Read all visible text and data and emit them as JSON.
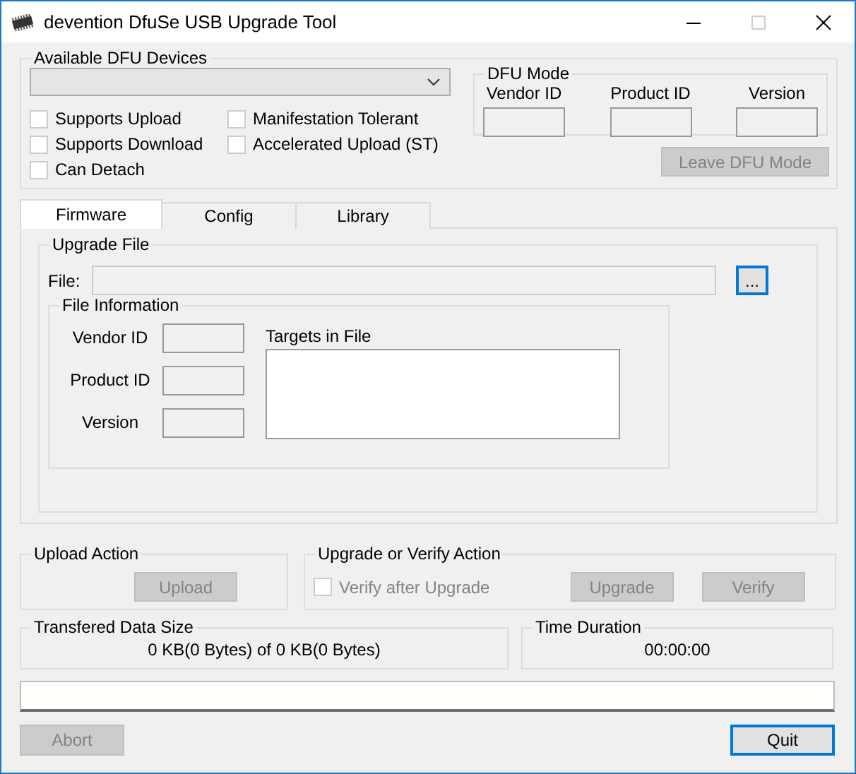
{
  "window": {
    "title": "devention DfuSe USB Upgrade Tool"
  },
  "devices": {
    "title": "Available DFU Devices",
    "capabilities": [
      {
        "label": "Supports Upload",
        "checked": false
      },
      {
        "label": "Supports Download",
        "checked": false
      },
      {
        "label": "Can Detach",
        "checked": false
      },
      {
        "label": "Manifestation Tolerant",
        "checked": false
      },
      {
        "label": "Accelerated Upload (ST)",
        "checked": false
      }
    ],
    "dfu_mode": {
      "title": "DFU Mode",
      "fields": [
        "Vendor ID",
        "Product ID",
        "Version"
      ]
    },
    "leave_button": {
      "label": "Leave DFU Mode",
      "disabled": true
    }
  },
  "tabs": [
    {
      "label": "Firmware",
      "selected": true
    },
    {
      "label": "Config",
      "selected": false
    },
    {
      "label": "Library",
      "selected": false
    }
  ],
  "upgrade_file": {
    "title": "Upgrade File",
    "file_label": "File:",
    "browse_button": "...",
    "file_info": {
      "title": "File Information",
      "fields": [
        "Vendor ID",
        "Product ID",
        "Version"
      ],
      "targets_label": "Targets in File"
    }
  },
  "upload_action": {
    "title": "Upload Action",
    "button": {
      "label": "Upload",
      "disabled": true
    }
  },
  "upgrade_action": {
    "title": "Upgrade or Verify Action",
    "verify_checkbox": {
      "label": "Verify after Upgrade",
      "checked": false,
      "disabled": true
    },
    "buttons": [
      {
        "label": "Upgrade",
        "disabled": true
      },
      {
        "label": "Verify",
        "disabled": true
      }
    ]
  },
  "transfer": {
    "title": "Transfered Data Size",
    "value": "0 KB(0 Bytes) of 0 KB(0 Bytes)"
  },
  "duration": {
    "title": "Time Duration",
    "value": "00:00:00"
  },
  "progress": {
    "level": 0
  },
  "buttons": [
    {
      "label": "Abort",
      "disabled": true
    },
    {
      "label": "Quit",
      "disabled": false
    }
  ]
}
